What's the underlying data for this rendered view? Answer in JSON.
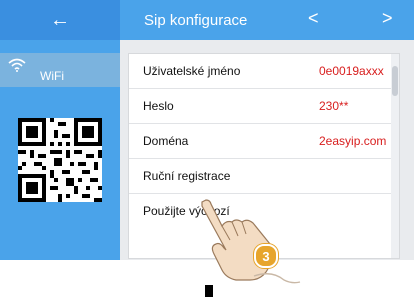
{
  "header": {
    "back_icon": "←",
    "title": "Sip konfigurace",
    "prev_icon": "<",
    "next_icon": ">"
  },
  "sidebar": {
    "wifi_label": "WiFi"
  },
  "list": [
    {
      "label": "Uživatelské jméno",
      "value": "0e0019axxx"
    },
    {
      "label": "Heslo",
      "value": "230**"
    },
    {
      "label": "Doména",
      "value": "2easyip.com"
    },
    {
      "label": "Ruční registrace",
      "value": ""
    },
    {
      "label": "Použijte výchozí",
      "value": ""
    }
  ],
  "step_badge": "3",
  "colors": {
    "primary": "#4aa3ea",
    "accent_red": "#d81e1e",
    "badge": "#e7a52c"
  }
}
